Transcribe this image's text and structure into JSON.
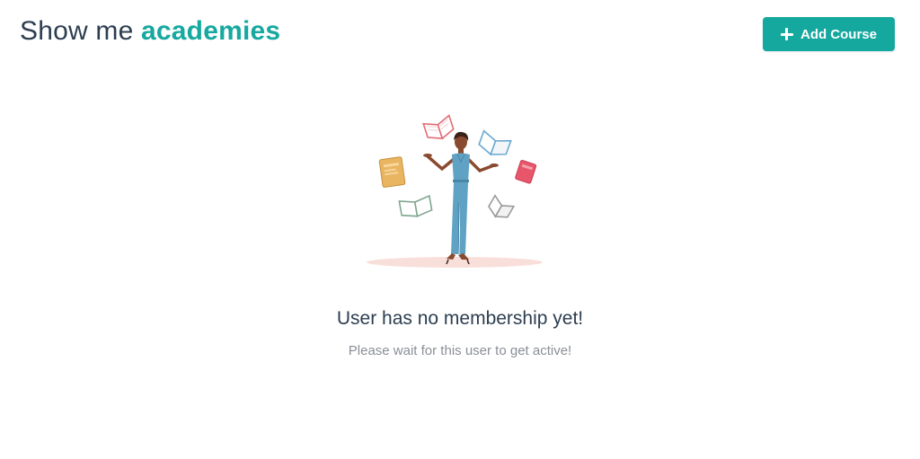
{
  "header": {
    "title_prefix": "Show me",
    "title_accent": "academies",
    "add_button_label": "Add Course"
  },
  "empty_state": {
    "title": "User has no membership yet!",
    "subtitle": "Please wait for this user to get active!"
  },
  "colors": {
    "accent": "#17a8a0",
    "button_bg": "#15a89f",
    "title_text": "#2d3e50",
    "subtitle_text": "#8a8f96"
  },
  "icons": {
    "add_button_icon": "plus-icon",
    "illustration": "woman-juggling-books-illustration"
  }
}
